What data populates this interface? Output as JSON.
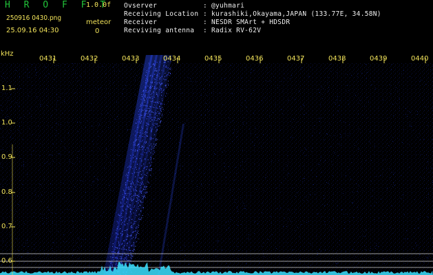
{
  "header": {
    "brand": "H R O F F T",
    "version": "1.0.0f",
    "filename": "250916 0430.png",
    "mode": "meteor",
    "datetime": "25.09.16 04:30",
    "count": "0"
  },
  "info": [
    {
      "label": "Ovserver",
      "value": "@yuhmari"
    },
    {
      "label": "Receiving Location",
      "value": "kurashiki,Okayama,JAPAN (133.77E, 34.58N)"
    },
    {
      "label": "Receiver",
      "value": "NESDR SMArt + HDSDR"
    },
    {
      "label": "Recviving antenna",
      "value": "Radix RV-62V"
    }
  ],
  "axis": {
    "y_unit": "kHz",
    "x_ticks": [
      "0431",
      "0432",
      "0433",
      "0434",
      "0435",
      "0436",
      "0437",
      "0438",
      "0439",
      "0440"
    ],
    "y_ticks": [
      "1.1",
      "1.0",
      "0.9",
      "0.8",
      "0.7",
      "0.6"
    ]
  },
  "colors": {
    "label": "#f2e35a",
    "brand": "#22c43a",
    "signal": "#2a4cff",
    "spectrum": "#3be0ff"
  }
}
